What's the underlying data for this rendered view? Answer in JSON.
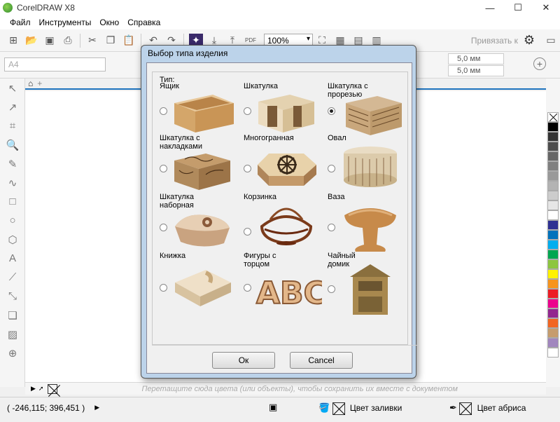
{
  "window": {
    "title": "CorelDRAW X8",
    "minimize": "—",
    "maximize": "☐",
    "close": "✕"
  },
  "menu": [
    "Файл",
    "Инструменты",
    "Окно",
    "Справка"
  ],
  "toolbar": {
    "zoom": "100%",
    "snap_label": "Привязать к",
    "pdf": "PDF"
  },
  "propbar": {
    "page_size": "A4",
    "nudge1": "5,0 мм",
    "nudge2": "5,0 мм"
  },
  "dialog": {
    "title": "Выбор типа изделия",
    "group_label": "Тип:",
    "items": [
      {
        "label": "Ящик",
        "checked": false
      },
      {
        "label": "Шкатулка",
        "checked": false
      },
      {
        "label": "Шкатулка с прорезью",
        "checked": true
      },
      {
        "label": "Шкатулка с накладками",
        "checked": false
      },
      {
        "label": "Многогранная",
        "checked": false
      },
      {
        "label": "Овал",
        "checked": false
      },
      {
        "label": "Шкатулка наборная",
        "checked": false
      },
      {
        "label": "Корзинка",
        "checked": false
      },
      {
        "label": "Ваза",
        "checked": false
      },
      {
        "label": "Книжка",
        "checked": false
      },
      {
        "label": "Фигуры с торцом",
        "checked": false
      },
      {
        "label": "Чайный домик",
        "checked": false
      }
    ],
    "abc_text": "ABC",
    "ok": "Ок",
    "cancel": "Cancel"
  },
  "docpal_hint": "Перетащите сюда цвета (или объекты), чтобы сохранить их вместе с документом",
  "status": {
    "coords": "( -246,115; 396,451 )",
    "fill": "Цвет заливки",
    "outline": "Цвет абриса"
  },
  "palette_colors": [
    "#000000",
    "#333333",
    "#4d4d4d",
    "#666666",
    "#808080",
    "#999999",
    "#b3b3b3",
    "#cccccc",
    "#e6e6e6",
    "#ffffff",
    "#2e3192",
    "#0072bc",
    "#00aeef",
    "#00a651",
    "#8dc63f",
    "#fff200",
    "#f7941d",
    "#ed1c24",
    "#ec008c",
    "#92278f",
    "#f26522",
    "#c69c6d",
    "#a186be",
    "#ffffff"
  ]
}
